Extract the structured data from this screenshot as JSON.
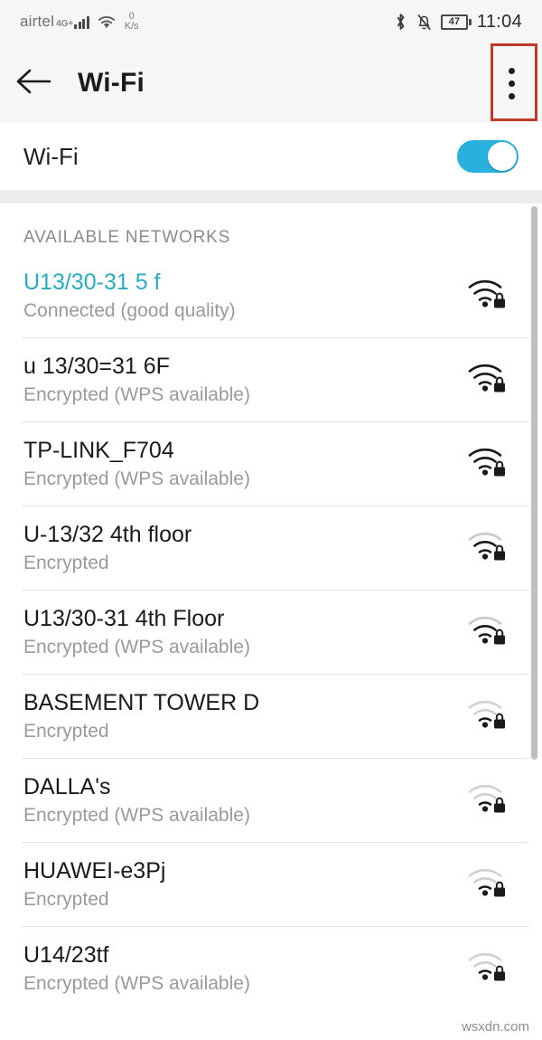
{
  "statusbar": {
    "carrier": "airtel",
    "network_type": "4G+",
    "data_rate_value": "0",
    "data_rate_unit": "K/s",
    "bluetooth_icon": "bluetooth-icon",
    "silent_icon": "bell-muted-icon",
    "battery_percent": "47",
    "time": "11:04"
  },
  "appbar": {
    "back_icon": "back-arrow-icon",
    "title": "Wi-Fi",
    "overflow_icon": "overflow-menu-icon"
  },
  "wifi_toggle": {
    "label": "Wi-Fi",
    "state": "on",
    "accent_color": "#29b1dd"
  },
  "list": {
    "section_header": "AVAILABLE NETWORKS",
    "connected_color": "#2aacc0",
    "networks": [
      {
        "ssid": "U13/30-31 5 f",
        "status": "Connected (good quality)",
        "connected": true,
        "signal": "strong",
        "secured": true
      },
      {
        "ssid": "u 13/30=31 6F",
        "status": "Encrypted (WPS available)",
        "connected": false,
        "signal": "strong",
        "secured": true
      },
      {
        "ssid": "TP-LINK_F704",
        "status": "Encrypted (WPS available)",
        "connected": false,
        "signal": "strong",
        "secured": true
      },
      {
        "ssid": "U-13/32 4th floor",
        "status": "Encrypted",
        "connected": false,
        "signal": "medium",
        "secured": true
      },
      {
        "ssid": "U13/30-31 4th Floor",
        "status": "Encrypted (WPS available)",
        "connected": false,
        "signal": "medium",
        "secured": true
      },
      {
        "ssid": "BASEMENT TOWER D",
        "status": "Encrypted",
        "connected": false,
        "signal": "weak",
        "secured": true
      },
      {
        "ssid": "DALLA's",
        "status": "Encrypted (WPS available)",
        "connected": false,
        "signal": "weak",
        "secured": true
      },
      {
        "ssid": "HUAWEI-e3Pj",
        "status": "Encrypted",
        "connected": false,
        "signal": "weak",
        "secured": true
      },
      {
        "ssid": "U14/23tf",
        "status": "Encrypted (WPS available)",
        "connected": false,
        "signal": "weak",
        "secured": true
      }
    ]
  },
  "watermark": "wsxdn.com"
}
